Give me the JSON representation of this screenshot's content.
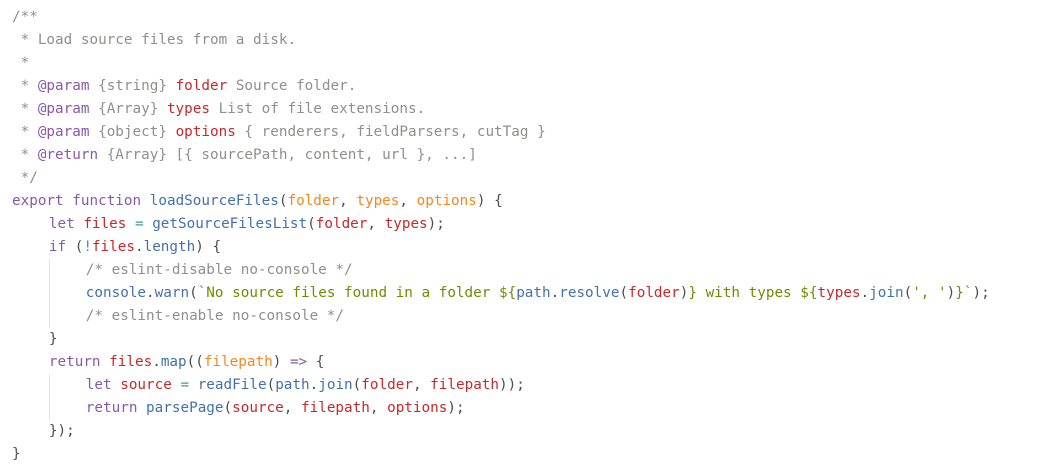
{
  "editor": {
    "theme": {
      "background": "#ffffff",
      "default": "#4d4d4c",
      "comment": "#8e908c",
      "tag": "#8959a8",
      "type": "#4d4d4c",
      "param": "#c82829",
      "keyword": "#8959a8",
      "function": "#4271ae",
      "variable": "#c82829",
      "parameter": "#f5871f",
      "string": "#718c00",
      "operator": "#3e999f",
      "punctuation": "#4d4d4c",
      "indent_guide": "#e4e4e4"
    },
    "lines": [
      {
        "indent": 0,
        "tokens": [
          {
            "t": "/**",
            "k": "comment"
          }
        ]
      },
      {
        "indent": 0,
        "tokens": [
          {
            "t": " * Load source files from a disk.",
            "k": "comment"
          }
        ]
      },
      {
        "indent": 0,
        "tokens": [
          {
            "t": " *",
            "k": "comment"
          }
        ]
      },
      {
        "indent": 0,
        "tokens": [
          {
            "t": " * ",
            "k": "comment"
          },
          {
            "t": "@param",
            "k": "tag"
          },
          {
            "t": " {string} ",
            "k": "comment"
          },
          {
            "t": "folder",
            "k": "param"
          },
          {
            "t": " Source folder.",
            "k": "comment"
          }
        ]
      },
      {
        "indent": 0,
        "tokens": [
          {
            "t": " * ",
            "k": "comment"
          },
          {
            "t": "@param",
            "k": "tag"
          },
          {
            "t": " {Array} ",
            "k": "comment"
          },
          {
            "t": "types",
            "k": "param"
          },
          {
            "t": " List of file extensions.",
            "k": "comment"
          }
        ]
      },
      {
        "indent": 0,
        "tokens": [
          {
            "t": " * ",
            "k": "comment"
          },
          {
            "t": "@param",
            "k": "tag"
          },
          {
            "t": " {object} ",
            "k": "comment"
          },
          {
            "t": "options",
            "k": "param"
          },
          {
            "t": " { renderers, fieldParsers, cutTag }",
            "k": "comment"
          }
        ]
      },
      {
        "indent": 0,
        "tokens": [
          {
            "t": " * ",
            "k": "comment"
          },
          {
            "t": "@return",
            "k": "tag"
          },
          {
            "t": " {Array} [{ sourcePath, content, url }, ...]",
            "k": "comment"
          }
        ]
      },
      {
        "indent": 0,
        "tokens": [
          {
            "t": " */",
            "k": "comment"
          }
        ]
      },
      {
        "indent": 0,
        "tokens": [
          {
            "t": "export",
            "k": "keyword"
          },
          {
            "t": " ",
            "k": "punctuation"
          },
          {
            "t": "function",
            "k": "keyword"
          },
          {
            "t": " ",
            "k": "punctuation"
          },
          {
            "t": "loadSourceFiles",
            "k": "function"
          },
          {
            "t": "(",
            "k": "punctuation"
          },
          {
            "t": "folder",
            "k": "parameter"
          },
          {
            "t": ", ",
            "k": "punctuation"
          },
          {
            "t": "types",
            "k": "parameter"
          },
          {
            "t": ", ",
            "k": "punctuation"
          },
          {
            "t": "options",
            "k": "parameter"
          },
          {
            "t": ") {",
            "k": "punctuation"
          }
        ]
      },
      {
        "indent": 1,
        "tokens": [
          {
            "t": "let",
            "k": "keyword"
          },
          {
            "t": " ",
            "k": "punctuation"
          },
          {
            "t": "files",
            "k": "variable"
          },
          {
            "t": " ",
            "k": "punctuation"
          },
          {
            "t": "=",
            "k": "operator"
          },
          {
            "t": " ",
            "k": "punctuation"
          },
          {
            "t": "getSourceFilesList",
            "k": "function"
          },
          {
            "t": "(",
            "k": "punctuation"
          },
          {
            "t": "folder",
            "k": "variable"
          },
          {
            "t": ", ",
            "k": "punctuation"
          },
          {
            "t": "types",
            "k": "variable"
          },
          {
            "t": ");",
            "k": "punctuation"
          }
        ]
      },
      {
        "indent": 1,
        "tokens": [
          {
            "t": "if",
            "k": "keyword"
          },
          {
            "t": " (",
            "k": "punctuation"
          },
          {
            "t": "!",
            "k": "operator"
          },
          {
            "t": "files",
            "k": "variable"
          },
          {
            "t": ".",
            "k": "punctuation"
          },
          {
            "t": "length",
            "k": "function"
          },
          {
            "t": ") {",
            "k": "punctuation"
          }
        ]
      },
      {
        "indent": 2,
        "tokens": [
          {
            "t": "/* eslint-disable no-console */",
            "k": "comment"
          }
        ]
      },
      {
        "indent": 2,
        "tokens": [
          {
            "t": "console",
            "k": "function"
          },
          {
            "t": ".",
            "k": "punctuation"
          },
          {
            "t": "warn",
            "k": "function"
          },
          {
            "t": "(",
            "k": "punctuation"
          },
          {
            "t": "`No source files found in a folder ",
            "k": "string"
          },
          {
            "t": "${",
            "k": "string"
          },
          {
            "t": "path",
            "k": "function"
          },
          {
            "t": ".",
            "k": "punctuation"
          },
          {
            "t": "resolve",
            "k": "function"
          },
          {
            "t": "(",
            "k": "punctuation"
          },
          {
            "t": "folder",
            "k": "variable"
          },
          {
            "t": ")",
            "k": "punctuation"
          },
          {
            "t": "}",
            "k": "string"
          },
          {
            "t": " with types ",
            "k": "string"
          },
          {
            "t": "${",
            "k": "string"
          },
          {
            "t": "types",
            "k": "variable"
          },
          {
            "t": ".",
            "k": "punctuation"
          },
          {
            "t": "join",
            "k": "function"
          },
          {
            "t": "(",
            "k": "punctuation"
          },
          {
            "t": "', '",
            "k": "string"
          },
          {
            "t": ")",
            "k": "punctuation"
          },
          {
            "t": "}`",
            "k": "string"
          },
          {
            "t": ");",
            "k": "punctuation"
          }
        ]
      },
      {
        "indent": 2,
        "tokens": [
          {
            "t": "/* eslint-enable no-console */",
            "k": "comment"
          }
        ]
      },
      {
        "indent": 1,
        "tokens": [
          {
            "t": "}",
            "k": "punctuation"
          }
        ]
      },
      {
        "indent": 1,
        "tokens": [
          {
            "t": "return",
            "k": "keyword"
          },
          {
            "t": " ",
            "k": "punctuation"
          },
          {
            "t": "files",
            "k": "variable"
          },
          {
            "t": ".",
            "k": "punctuation"
          },
          {
            "t": "map",
            "k": "function"
          },
          {
            "t": "((",
            "k": "punctuation"
          },
          {
            "t": "filepath",
            "k": "parameter"
          },
          {
            "t": ") ",
            "k": "punctuation"
          },
          {
            "t": "=>",
            "k": "keyword"
          },
          {
            "t": " {",
            "k": "punctuation"
          }
        ]
      },
      {
        "indent": 2,
        "tokens": [
          {
            "t": "let",
            "k": "keyword"
          },
          {
            "t": " ",
            "k": "punctuation"
          },
          {
            "t": "source",
            "k": "variable"
          },
          {
            "t": " ",
            "k": "punctuation"
          },
          {
            "t": "=",
            "k": "operator"
          },
          {
            "t": " ",
            "k": "punctuation"
          },
          {
            "t": "readFile",
            "k": "function"
          },
          {
            "t": "(",
            "k": "punctuation"
          },
          {
            "t": "path",
            "k": "function"
          },
          {
            "t": ".",
            "k": "punctuation"
          },
          {
            "t": "join",
            "k": "function"
          },
          {
            "t": "(",
            "k": "punctuation"
          },
          {
            "t": "folder",
            "k": "variable"
          },
          {
            "t": ", ",
            "k": "punctuation"
          },
          {
            "t": "filepath",
            "k": "variable"
          },
          {
            "t": "));",
            "k": "punctuation"
          }
        ]
      },
      {
        "indent": 2,
        "tokens": [
          {
            "t": "return",
            "k": "keyword"
          },
          {
            "t": " ",
            "k": "punctuation"
          },
          {
            "t": "parsePage",
            "k": "function"
          },
          {
            "t": "(",
            "k": "punctuation"
          },
          {
            "t": "source",
            "k": "variable"
          },
          {
            "t": ", ",
            "k": "punctuation"
          },
          {
            "t": "filepath",
            "k": "variable"
          },
          {
            "t": ", ",
            "k": "punctuation"
          },
          {
            "t": "options",
            "k": "variable"
          },
          {
            "t": ");",
            "k": "punctuation"
          }
        ]
      },
      {
        "indent": 1,
        "tokens": [
          {
            "t": "});",
            "k": "punctuation"
          }
        ]
      },
      {
        "indent": 0,
        "tokens": [
          {
            "t": "}",
            "k": "punctuation"
          }
        ]
      }
    ]
  }
}
